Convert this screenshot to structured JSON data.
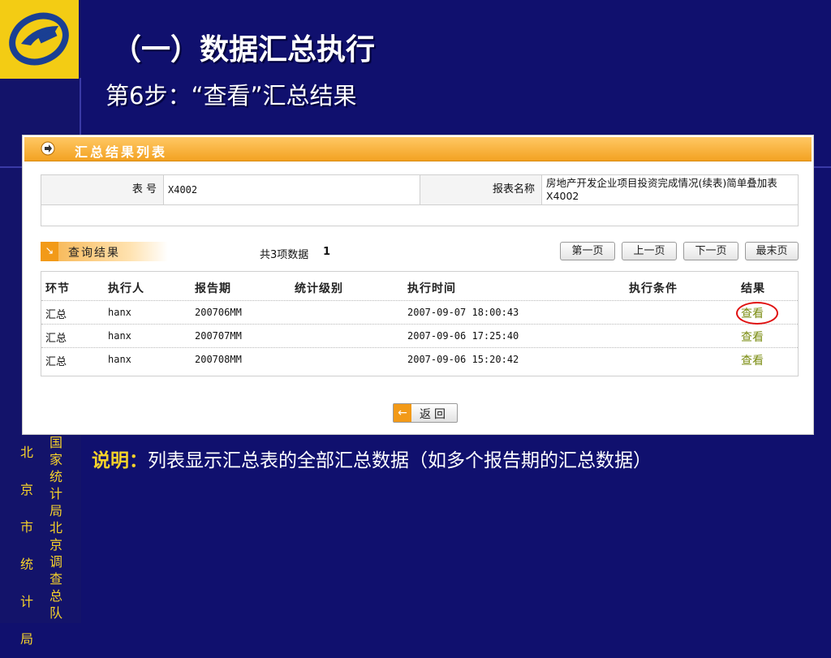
{
  "slide": {
    "title": "（一）数据汇总执行",
    "subtitle": "第6步：“查看”汇总结果",
    "vertical_org_columns": [
      "国家统计局北京调查总队",
      "北京市统计局"
    ],
    "note_label": "说明：",
    "note_text": "列表显示汇总表的全部汇总数据（如多个报告期的汇总数据）"
  },
  "panel": {
    "title": "汇总结果列表",
    "info": {
      "table_no_label": "表 号",
      "table_no_value": "X4002",
      "table_name_label": "报表名称",
      "table_name_value": "房地产开发企业项目投资完成情况(续表)简单叠加表X4002"
    },
    "query_title": "查询结果",
    "count_text": "共3项数据",
    "page_number": "1",
    "pagination": {
      "first": "第一页",
      "prev": "上一页",
      "next": "下一页",
      "last": "最末页"
    },
    "columns": [
      "环节",
      "执行人",
      "报告期",
      "统计级别",
      "执行时间",
      "执行条件",
      "结果"
    ],
    "rows": [
      {
        "stage": "汇总",
        "executor": "hanx",
        "period": "200706MM",
        "level": "",
        "time": "2007-09-07 18:00:43",
        "condition": "",
        "result": "查看"
      },
      {
        "stage": "汇总",
        "executor": "hanx",
        "period": "200707MM",
        "level": "",
        "time": "2007-09-06 17:25:40",
        "condition": "",
        "result": "查看"
      },
      {
        "stage": "汇总",
        "executor": "hanx",
        "period": "200708MM",
        "level": "",
        "time": "2007-09-06 15:20:42",
        "condition": "",
        "result": "查看"
      }
    ],
    "back_label": "返回"
  },
  "colors": {
    "background": "#10106e",
    "title_text": "#ffffff",
    "accent_yellow": "#f6d22a",
    "header_orange": "#f3a222",
    "link_green": "#7a8c10",
    "highlight_red": "#e01010"
  },
  "icons": [
    "logo-icon",
    "arrow-right-icon",
    "query-arrow-icon",
    "back-arrow-icon"
  ]
}
